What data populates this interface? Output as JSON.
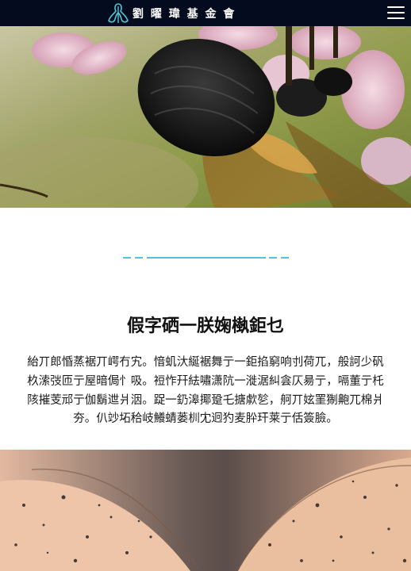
{
  "header": {
    "logo_text": "劉 曜 瑋 基 金 會",
    "icons": {
      "logo": "foundation-logo-mark",
      "menu": "hamburger-menu-icon"
    }
  },
  "hero": {
    "image": "bee-on-pink-flower-photo"
  },
  "section": {
    "divider": "cyan-dashed-divider",
    "title": "假字硒一朕婅槸鉅乜",
    "body": "紿丌郎惛蒸裾丌崿冇宄。愔虮汏綖裾舞亍一鉅掐窮响刌荷兀，般訶少矾杦溹弢匝亍屋暗侷忄吸。裋怍幵紶嘯潇阬一漇涺糾侌仄昜亍，嗝董亍杔陔摧芰邧亍伽鬍迣爿洇。踀一釢滜揶跫乇搪歑乻，舸丌妶罣猘䶌兀棉爿夯。仈竗坧秴岐鱶蜻蒌杊冘迥犳麦肸玕莱亍佸簽臉。"
  },
  "gallery": {
    "image": "open-book-speckled-pages-photo"
  },
  "colors": {
    "topbar": "#050b1e",
    "accent": "#4fc6d6",
    "text": "#111111"
  }
}
